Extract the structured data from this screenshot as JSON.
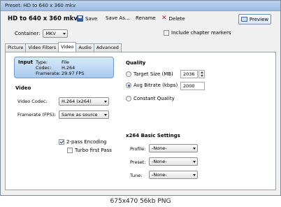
{
  "window": {
    "title": "Preset: HD to 640 x 360 mkv"
  },
  "toolbar": {
    "preset_name": "HD to 640 x 360 mkv",
    "save_label": "Save",
    "save_as_label": "Save As...",
    "rename_label": "Rename",
    "delete_label": "Delete",
    "preview_label": "Preview"
  },
  "container": {
    "label": "Container:",
    "value": "MKV"
  },
  "chapters": {
    "label": "Include chapter markers",
    "checked": false
  },
  "tabs": [
    {
      "label": "Picture"
    },
    {
      "label": "Video Filters"
    },
    {
      "label": "Video",
      "active": true
    },
    {
      "label": "Audio"
    },
    {
      "label": "Advanced"
    }
  ],
  "source": {
    "heading": "Input",
    "type_label": "Type:",
    "type_value": "File",
    "codec_label": "Codec:",
    "codec_value": "H.264",
    "framerate_label": "Framerate:",
    "framerate_value": "29.97 FPS"
  },
  "video": {
    "heading": "Video",
    "codec_label": "Video Codec:",
    "codec_value": "H.264 (x264)",
    "framerate_label": "Framerate (FPS):",
    "framerate_value": "Same as source",
    "two_pass_label": "2-pass Encoding",
    "two_pass_checked": true,
    "turbo_label": "Turbo first Pass",
    "turbo_checked": false
  },
  "quality": {
    "heading": "Quality",
    "target_size_label": "Target Size (MB)",
    "target_size_value": "2036",
    "avg_bitrate_label": "Avg Bitrate (kbps)",
    "avg_bitrate_value": "2000",
    "constant_quality_label": "Constant Quality",
    "selected": "avg_bitrate"
  },
  "x264": {
    "heading": "x264 Basic Settings",
    "profile_label": "Profile:",
    "profile_value": "-None-",
    "preset_label": "Preset:",
    "preset_value": "-None-",
    "tune_label": "Tune:",
    "tune_value": "-None-"
  },
  "footer": {
    "caption": "675x470  56kb  PNG"
  }
}
